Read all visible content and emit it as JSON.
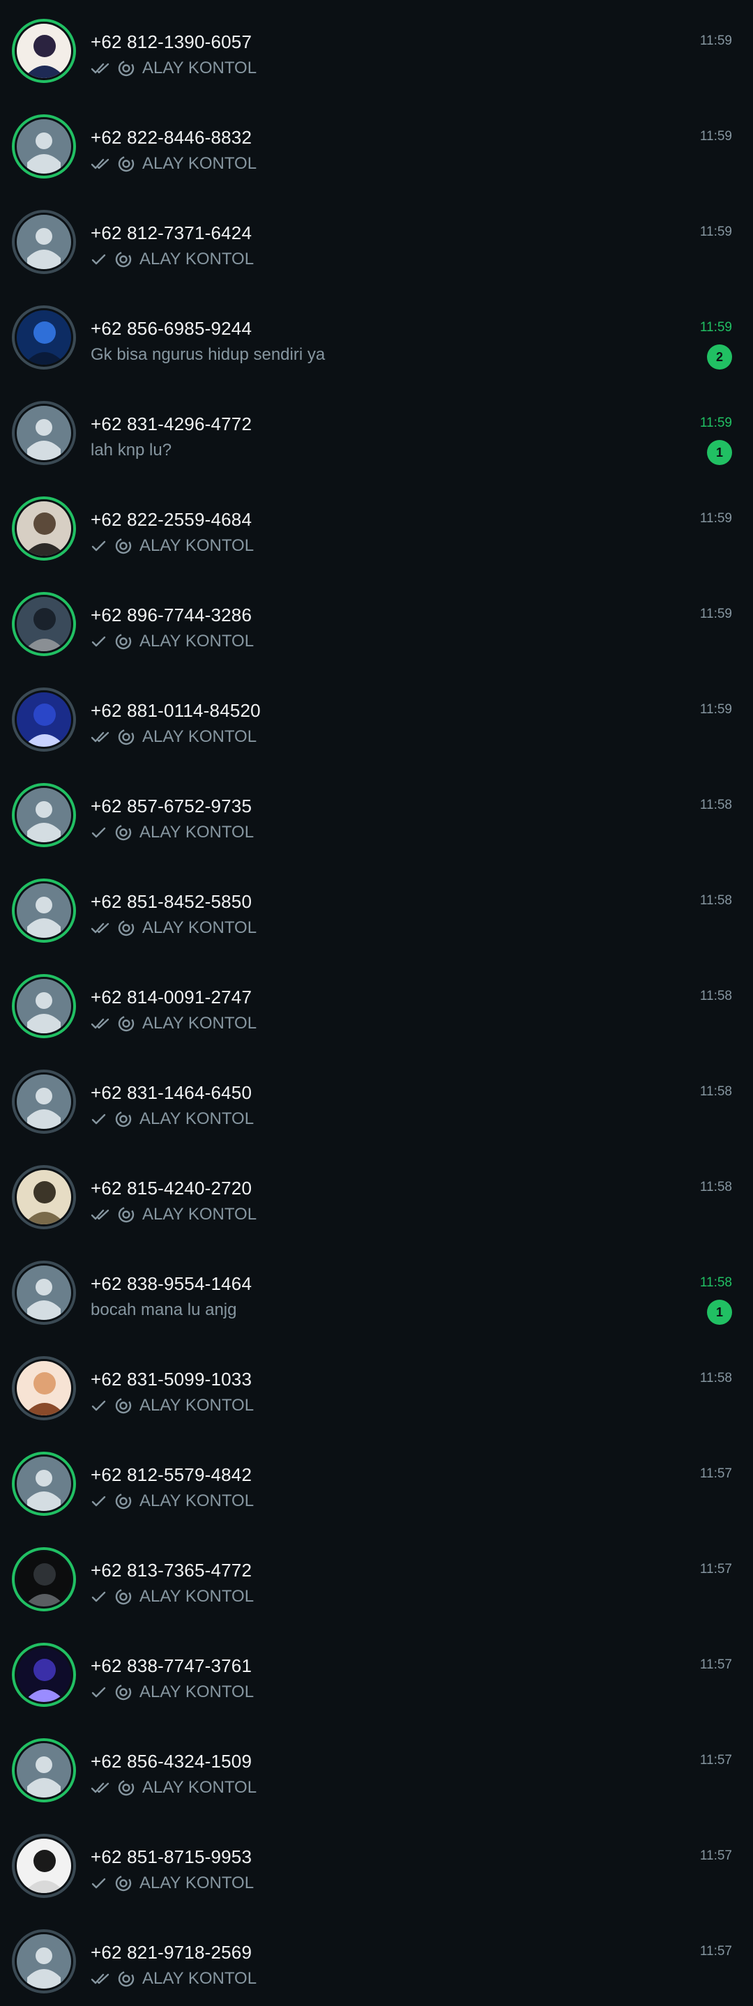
{
  "colors": {
    "background": "#0b1014",
    "accent": "#21c063",
    "muted": "#8696a0",
    "ring_default": "#3b4a54"
  },
  "chats": [
    {
      "name": "+62 812-1390-6057",
      "time": "11:59",
      "ticks": "double",
      "preview": "ALAY KONTOL",
      "has_icon": true,
      "unread": "",
      "status_ring": true,
      "avatar": "photo-anime-boy"
    },
    {
      "name": "+62 822-8446-8832",
      "time": "11:59",
      "ticks": "double",
      "preview": "ALAY KONTOL",
      "has_icon": true,
      "unread": "",
      "status_ring": true,
      "avatar": "default"
    },
    {
      "name": "+62 812-7371-6424",
      "time": "11:59",
      "ticks": "single",
      "preview": "ALAY KONTOL",
      "has_icon": true,
      "unread": "",
      "status_ring": false,
      "avatar": "default"
    },
    {
      "name": "+62 856-6985-9244",
      "time": "11:59",
      "ticks": "none",
      "preview": "Gk bisa ngurus hidup sendiri ya",
      "has_icon": false,
      "unread": "2",
      "status_ring": false,
      "avatar": "photo-blue"
    },
    {
      "name": "+62 831-4296-4772",
      "time": "11:59",
      "ticks": "none",
      "preview": "lah knp lu?",
      "has_icon": false,
      "unread": "1",
      "status_ring": false,
      "avatar": "default"
    },
    {
      "name": "+62 822-2559-4684",
      "time": "11:59",
      "ticks": "single",
      "preview": "ALAY KONTOL",
      "has_icon": true,
      "unread": "",
      "status_ring": true,
      "avatar": "photo-person"
    },
    {
      "name": "+62 896-7744-3286",
      "time": "11:59",
      "ticks": "single",
      "preview": "ALAY KONTOL",
      "has_icon": true,
      "unread": "",
      "status_ring": true,
      "avatar": "photo-dark"
    },
    {
      "name": "+62 881-0114-84520",
      "time": "11:59",
      "ticks": "double",
      "preview": "ALAY KONTOL",
      "has_icon": true,
      "unread": "",
      "status_ring": false,
      "avatar": "photo-jersey"
    },
    {
      "name": "+62 857-6752-9735",
      "time": "11:58",
      "ticks": "single",
      "preview": "ALAY KONTOL",
      "has_icon": true,
      "unread": "",
      "status_ring": true,
      "avatar": "default"
    },
    {
      "name": "+62 851-8452-5850",
      "time": "11:58",
      "ticks": "double",
      "preview": "ALAY KONTOL",
      "has_icon": true,
      "unread": "",
      "status_ring": true,
      "avatar": "default"
    },
    {
      "name": "+62 814-0091-2747",
      "time": "11:58",
      "ticks": "double",
      "preview": "ALAY KONTOL",
      "has_icon": true,
      "unread": "",
      "status_ring": true,
      "avatar": "default"
    },
    {
      "name": "+62 831-1464-6450",
      "time": "11:58",
      "ticks": "single",
      "preview": "ALAY KONTOL",
      "has_icon": true,
      "unread": "",
      "status_ring": false,
      "avatar": "default"
    },
    {
      "name": "+62 815-4240-2720",
      "time": "11:58",
      "ticks": "double",
      "preview": "ALAY KONTOL",
      "has_icon": true,
      "unread": "",
      "status_ring": false,
      "avatar": "photo-poster"
    },
    {
      "name": "+62 838-9554-1464",
      "time": "11:58",
      "ticks": "none",
      "preview": "bocah mana lu anjg",
      "has_icon": false,
      "unread": "1",
      "status_ring": false,
      "avatar": "default"
    },
    {
      "name": "+62 831-5099-1033",
      "time": "11:58",
      "ticks": "single",
      "preview": "ALAY KONTOL",
      "has_icon": true,
      "unread": "",
      "status_ring": false,
      "avatar": "photo-anime-girl"
    },
    {
      "name": "+62 812-5579-4842",
      "time": "11:57",
      "ticks": "single",
      "preview": "ALAY KONTOL",
      "has_icon": true,
      "unread": "",
      "status_ring": true,
      "avatar": "default"
    },
    {
      "name": "+62 813-7365-4772",
      "time": "11:57",
      "ticks": "single",
      "preview": "ALAY KONTOL",
      "has_icon": true,
      "unread": "",
      "status_ring": true,
      "avatar": "photo-standing"
    },
    {
      "name": "+62 838-7747-3761",
      "time": "11:57",
      "ticks": "single",
      "preview": "ALAY KONTOL",
      "has_icon": true,
      "unread": "",
      "status_ring": true,
      "avatar": "photo-purple"
    },
    {
      "name": "+62 856-4324-1509",
      "time": "11:57",
      "ticks": "double",
      "preview": "ALAY KONTOL",
      "has_icon": true,
      "unread": "",
      "status_ring": true,
      "avatar": "default"
    },
    {
      "name": "+62 851-8715-9953",
      "time": "11:57",
      "ticks": "single",
      "preview": "ALAY KONTOL",
      "has_icon": true,
      "unread": "",
      "status_ring": false,
      "avatar": "photo-panda"
    },
    {
      "name": "+62 821-9718-2569",
      "time": "11:57",
      "ticks": "double",
      "preview": "ALAY KONTOL",
      "has_icon": true,
      "unread": "",
      "status_ring": false,
      "avatar": "default"
    }
  ]
}
